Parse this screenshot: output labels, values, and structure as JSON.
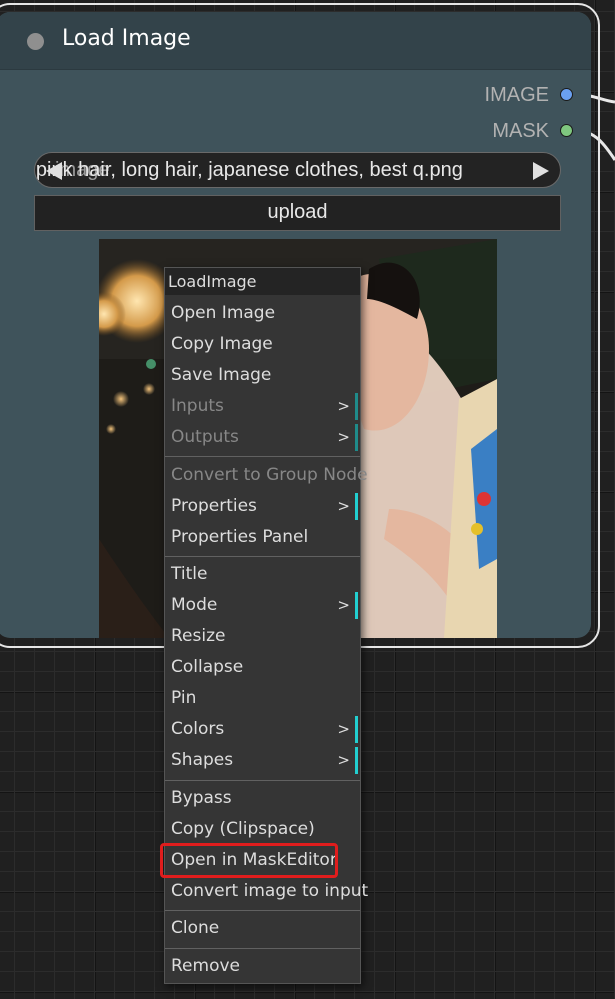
{
  "node": {
    "title": "Load Image",
    "outputs": [
      {
        "label": "IMAGE",
        "color": "#6aa0f0"
      },
      {
        "label": "MASK",
        "color": "#7fc77f"
      }
    ],
    "image_widget": {
      "label": "image",
      "value": "ers, pink hair, long hair, japanese clothes, best q.png"
    },
    "upload_label": "upload"
  },
  "context_menu": {
    "title": "LoadImage",
    "items": [
      {
        "label": "Open Image",
        "disabled": false,
        "submenu": false
      },
      {
        "label": "Copy Image",
        "disabled": false,
        "submenu": false
      },
      {
        "label": "Save Image",
        "disabled": false,
        "submenu": false
      },
      {
        "label": "Inputs",
        "disabled": true,
        "submenu": true
      },
      {
        "label": "Outputs",
        "disabled": true,
        "submenu": true
      },
      {
        "label": "Convert to Group Node",
        "disabled": true,
        "submenu": false
      },
      {
        "label": "Properties",
        "disabled": false,
        "submenu": true
      },
      {
        "label": "Properties Panel",
        "disabled": false,
        "submenu": false
      },
      {
        "label": "Title",
        "disabled": false,
        "submenu": false
      },
      {
        "label": "Mode",
        "disabled": false,
        "submenu": true
      },
      {
        "label": "Resize",
        "disabled": false,
        "submenu": false
      },
      {
        "label": "Collapse",
        "disabled": false,
        "submenu": false
      },
      {
        "label": "Pin",
        "disabled": false,
        "submenu": false
      },
      {
        "label": "Colors",
        "disabled": false,
        "submenu": true
      },
      {
        "label": "Shapes",
        "disabled": false,
        "submenu": true
      },
      {
        "label": "Bypass",
        "disabled": false,
        "submenu": false
      },
      {
        "label": "Copy (Clipspace)",
        "disabled": false,
        "submenu": false
      },
      {
        "label": "Open in MaskEditor",
        "disabled": false,
        "submenu": false,
        "highlighted": true
      },
      {
        "label": "Convert image to input",
        "disabled": false,
        "submenu": false
      },
      {
        "label": "Clone",
        "disabled": false,
        "submenu": false
      },
      {
        "label": "Remove",
        "disabled": false,
        "submenu": false
      }
    ],
    "submenu_glyph": ">"
  },
  "colors": {
    "accent_submenu": "#22cfd0",
    "highlight": "#e01d1d"
  }
}
